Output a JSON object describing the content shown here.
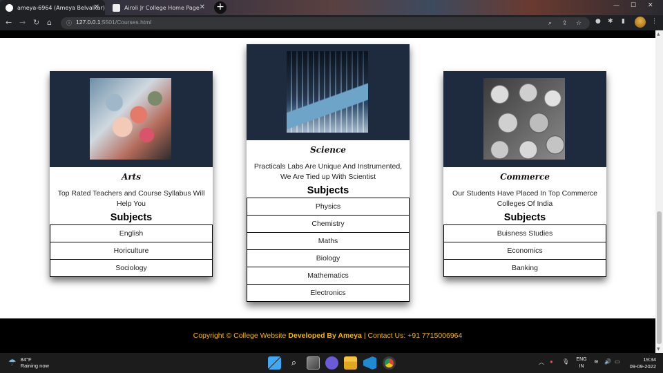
{
  "browser": {
    "tabs": [
      {
        "title": "ameya-6964 (Ameya Belvalkar)",
        "icon": "github-icon",
        "active": true
      },
      {
        "title": "Airoli Jr College Home Page",
        "icon": "page-icon",
        "active": false
      }
    ],
    "new_tab": "+",
    "url_host": "127.0.0.1",
    "url_rest": ":5501/Courses.html"
  },
  "cards": [
    {
      "name": "Arts",
      "description": "Top Rated Teachers and Course Syllabus Will Help You",
      "subjects_heading": "Subjects",
      "subjects": [
        "English",
        "Horiculture",
        "Sociology"
      ]
    },
    {
      "name": "Science",
      "description": "Practicals Labs Are Unique And Instrumented, We Are Tied up With Scientist",
      "subjects_heading": "Subjects",
      "subjects": [
        "Physics",
        "Chemistry",
        "Maths",
        "Biology",
        "Mathematics",
        "Electronics"
      ]
    },
    {
      "name": "Commerce",
      "description": "Our Students Have Placed In Top Commerce Colleges Of India",
      "subjects_heading": "Subjects",
      "subjects": [
        "Buisness Studies",
        "Economics",
        "Banking"
      ]
    }
  ],
  "footer": {
    "prefix": "Copyright © College Website",
    "developer": "Developed By Ameya",
    "contact": "| Contact Us: +91 7715006964"
  },
  "taskbar": {
    "temperature": "84°F",
    "weather": "Raining now",
    "lang_line1": "ENG",
    "lang_line2": "IN",
    "time": "19:34",
    "date": "09-09-2022"
  },
  "colors": {
    "card_header": "#1e2a3e",
    "footer_text": "#f5b800"
  }
}
